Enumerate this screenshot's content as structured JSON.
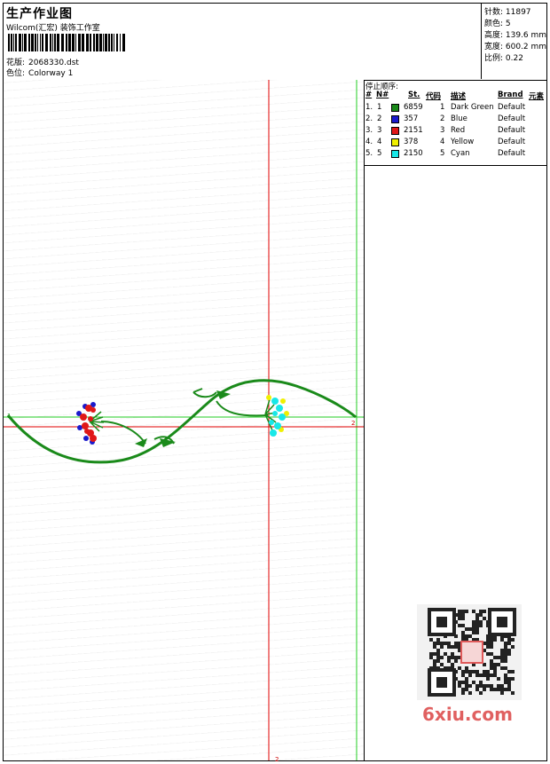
{
  "header": {
    "title": "生产作业图",
    "studio": "Wilcom(汇宏) 装饰工作室",
    "design_label": "花版:",
    "design_value": "2068330.dst",
    "colorway_label": "色位:",
    "colorway_value": "Colorway 1"
  },
  "stats": {
    "stitches": "针数: 11897",
    "colors": "颜色: 5",
    "height": "高度: 139.6 mm",
    "width": "宽度: 600.2 mm",
    "scale": "比例: 0.22"
  },
  "sequence": {
    "title": "停止顺序:",
    "headers": {
      "num": "#",
      "n": "N#",
      "st": "St.",
      "code": "代码",
      "desc": "描述",
      "brand": "Brand",
      "element": "元素"
    },
    "rows": [
      {
        "num": "1.",
        "n": "1",
        "color": "#1a8a1a",
        "st": "6859",
        "code": "1",
        "desc": "Dark Green",
        "brand": "Default"
      },
      {
        "num": "2.",
        "n": "2",
        "color": "#1a1acc",
        "st": "357",
        "code": "2",
        "desc": "Blue",
        "brand": "Default"
      },
      {
        "num": "3.",
        "n": "3",
        "color": "#e01818",
        "st": "2151",
        "code": "3",
        "desc": "Red",
        "brand": "Default"
      },
      {
        "num": "4.",
        "n": "4",
        "color": "#f0f000",
        "st": "378",
        "code": "4",
        "desc": "Yellow",
        "brand": "Default"
      },
      {
        "num": "5.",
        "n": "5",
        "color": "#18e8e8",
        "st": "2150",
        "code": "5",
        "desc": "Cyan",
        "brand": "Default"
      }
    ]
  },
  "watermark": {
    "site_main": "6xiu",
    "site_tld": ".com"
  },
  "markers": {
    "bottom": "2",
    "right": "2"
  }
}
